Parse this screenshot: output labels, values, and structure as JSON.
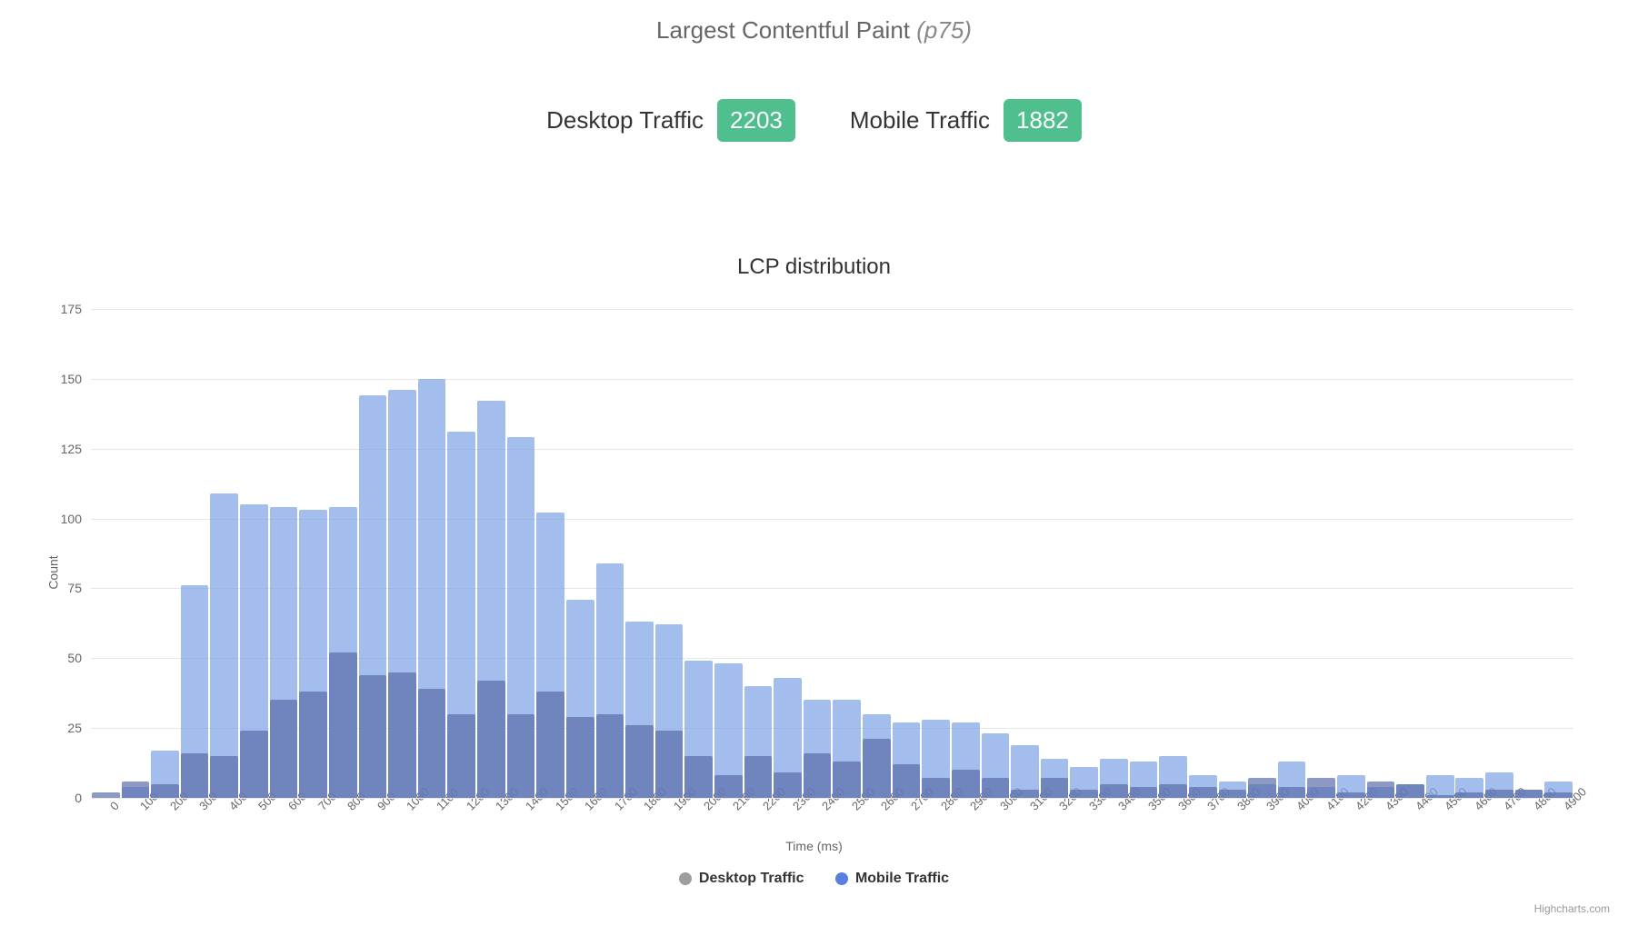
{
  "header": {
    "title": "Largest Contentful Paint",
    "stat_suffix": "(p75)"
  },
  "metrics": {
    "desktop": {
      "label": "Desktop Traffic",
      "value": "2203",
      "class": "good"
    },
    "mobile": {
      "label": "Mobile Traffic",
      "value": "1882",
      "class": "good"
    }
  },
  "chart_data": {
    "type": "bar",
    "title": "LCP distribution",
    "xlabel": "Time (ms)",
    "ylabel": "Count",
    "ylim": [
      0,
      175
    ],
    "yticks": [
      0,
      25,
      50,
      75,
      100,
      125,
      150,
      175
    ],
    "categories": [
      "0",
      "100",
      "200",
      "300",
      "400",
      "500",
      "600",
      "700",
      "800",
      "900",
      "1000",
      "1100",
      "1200",
      "1300",
      "1400",
      "1500",
      "1600",
      "1700",
      "1800",
      "1900",
      "2000",
      "2100",
      "2200",
      "2300",
      "2400",
      "2500",
      "2600",
      "2700",
      "2800",
      "2900",
      "3000",
      "3100",
      "3200",
      "3300",
      "3400",
      "3500",
      "3600",
      "3700",
      "3800",
      "3900",
      "4000",
      "4100",
      "4200",
      "4300",
      "4400",
      "4500",
      "4600",
      "4700",
      "4800",
      "4900"
    ],
    "series": [
      {
        "name": "Desktop Traffic",
        "color": "#9e9e9e",
        "values": [
          2,
          6,
          5,
          16,
          15,
          24,
          35,
          38,
          52,
          44,
          45,
          39,
          30,
          42,
          30,
          38,
          29,
          30,
          26,
          24,
          15,
          8,
          15,
          9,
          16,
          13,
          21,
          12,
          7,
          10,
          7,
          3,
          7,
          3,
          5,
          4,
          5,
          4,
          3,
          7,
          4,
          7,
          2,
          6,
          5,
          1,
          2,
          3,
          3,
          2
        ]
      },
      {
        "name": "Mobile Traffic",
        "color": "#7ca1e6",
        "values": [
          0,
          4,
          17,
          76,
          109,
          105,
          104,
          103,
          104,
          144,
          146,
          150,
          131,
          142,
          129,
          102,
          71,
          84,
          63,
          62,
          49,
          48,
          40,
          43,
          35,
          35,
          30,
          27,
          28,
          27,
          23,
          19,
          14,
          11,
          14,
          13,
          15,
          8,
          6,
          5,
          13,
          4,
          8,
          4,
          5,
          8,
          7,
          9,
          3,
          6
        ]
      }
    ],
    "legend": [
      {
        "name": "Desktop Traffic",
        "color": "desktop"
      },
      {
        "name": "Mobile Traffic",
        "color": "mobile"
      }
    ],
    "credits": "Highcharts.com"
  }
}
